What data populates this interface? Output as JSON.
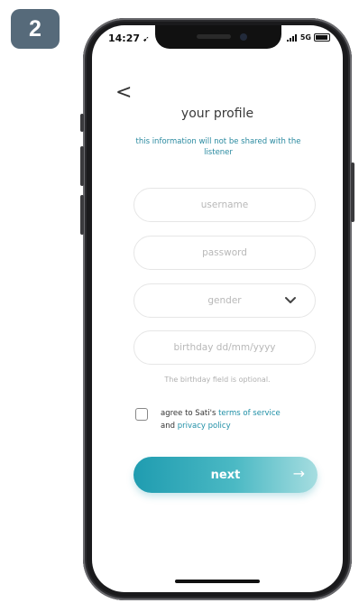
{
  "step_badge": "2",
  "status_bar": {
    "time": "14:27",
    "network": "5G"
  },
  "header": {
    "back": "<",
    "title": "your profile",
    "subtitle": "this information will not be shared with the listener"
  },
  "form": {
    "username_placeholder": "username",
    "password_placeholder": "password",
    "gender_value": "gender",
    "birthday_placeholder": "birthday dd/mm/yyyy",
    "birthday_hint": "The birthday field is optional.",
    "agree_prefix": "agree to Sati's ",
    "terms_link": "terms of service",
    "agree_and": "and ",
    "privacy_link": "privacy policy"
  },
  "next_button": {
    "label": "next",
    "arrow": "→"
  },
  "colors": {
    "accent": "#1f8fa6",
    "badge": "#566a7a",
    "button_start": "#1f9cb0",
    "button_end": "#a6dde0"
  }
}
